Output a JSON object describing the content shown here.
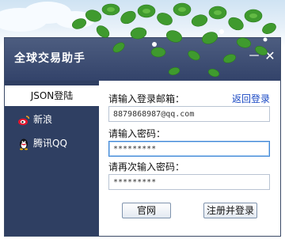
{
  "window": {
    "title": "全球交易助手",
    "minimize_glyph": "－",
    "close_glyph": "✕"
  },
  "sidebar": {
    "items": [
      {
        "label": "JSON登陆",
        "icon": "none",
        "active": true
      },
      {
        "label": "新浪",
        "icon": "weibo-icon",
        "active": false
      },
      {
        "label": "腾讯QQ",
        "icon": "qq-penguin-icon",
        "active": false
      }
    ]
  },
  "form": {
    "email_label": "请输入登录邮箱：",
    "back_link": "返回登录",
    "email_value": "8879868987@qq.com",
    "password_label": "请输入密码：",
    "password_value": "*********",
    "confirm_label": "请再次输入密码：",
    "confirm_value": "*********"
  },
  "buttons": {
    "website": "官网",
    "register_login": "注册并登录"
  },
  "colors": {
    "titlebar": "#3b4b70",
    "sidebar": "#2f3f62",
    "link": "#1a49c4",
    "focus_border": "#3f86d6"
  }
}
